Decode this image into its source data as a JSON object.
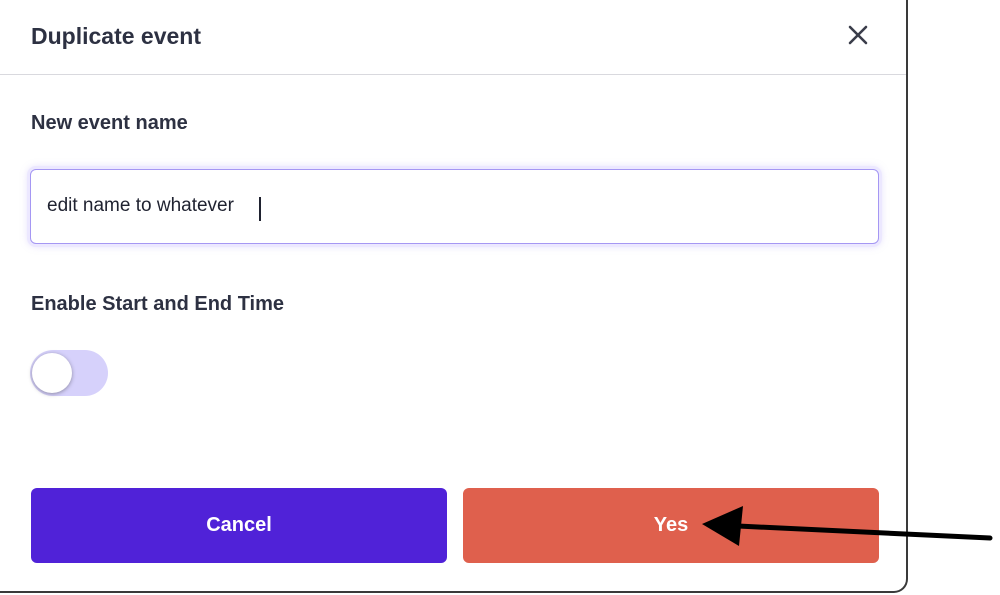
{
  "dialog": {
    "title": "Duplicate event",
    "close_icon": "close-icon",
    "fields": {
      "name_label": "New event name",
      "name_value": "edit name to whatever",
      "time_label": "Enable Start and End Time",
      "time_enabled": false
    },
    "buttons": {
      "cancel_label": "Cancel",
      "yes_label": "Yes"
    }
  },
  "annotation": {
    "arrow_icon": "arrow-left-icon"
  },
  "colors": {
    "primary": "#5022d8",
    "danger": "#df604d",
    "toggle_track": "#d6d1fb",
    "focus_border": "#a597f3"
  }
}
